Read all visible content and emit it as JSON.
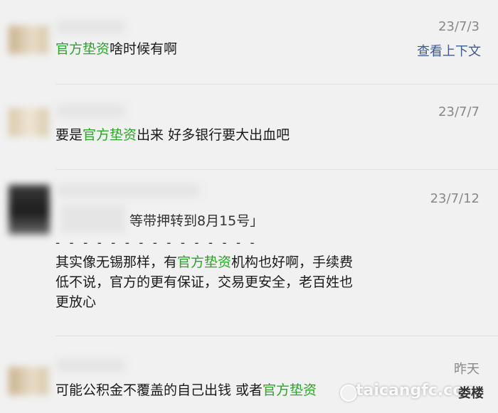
{
  "comments": [
    {
      "time": "23/7/3",
      "parts": [
        {
          "text": "官方垫资",
          "hl": true
        },
        {
          "text": "啥时候有啊",
          "hl": false
        }
      ],
      "context_link": "查看上下文"
    },
    {
      "time": "23/7/7",
      "parts": [
        {
          "text": "要是",
          "hl": false
        },
        {
          "text": "官方垫资",
          "hl": true
        },
        {
          "text": "出来  好多银行要大出血吧",
          "hl": false
        }
      ]
    },
    {
      "time": "23/7/12",
      "quote": "等带押转到8月15号」",
      "separator": "- - - - - - - - - - - - - - -",
      "line1_parts": [
        {
          "text": "其实像无锡那样，有",
          "hl": false
        },
        {
          "text": "官方垫资",
          "hl": true
        },
        {
          "text": "机构也好啊，手续费",
          "hl": false
        }
      ],
      "line2": "低不说，官方的更有保证，交易更安全，老百姓也",
      "line3": "更放心"
    },
    {
      "time": "昨天",
      "parts": [
        {
          "text": "可能公积金不覆盖的自己出钱 或者",
          "hl": false
        },
        {
          "text": "官方垫资",
          "hl": true
        }
      ]
    }
  ],
  "watermark": "taicangfc.com",
  "watermark_brand": "娄楼",
  "colors": {
    "highlight": "#2aa52a",
    "link": "#3d5a93",
    "background": "#f1f1f1"
  }
}
